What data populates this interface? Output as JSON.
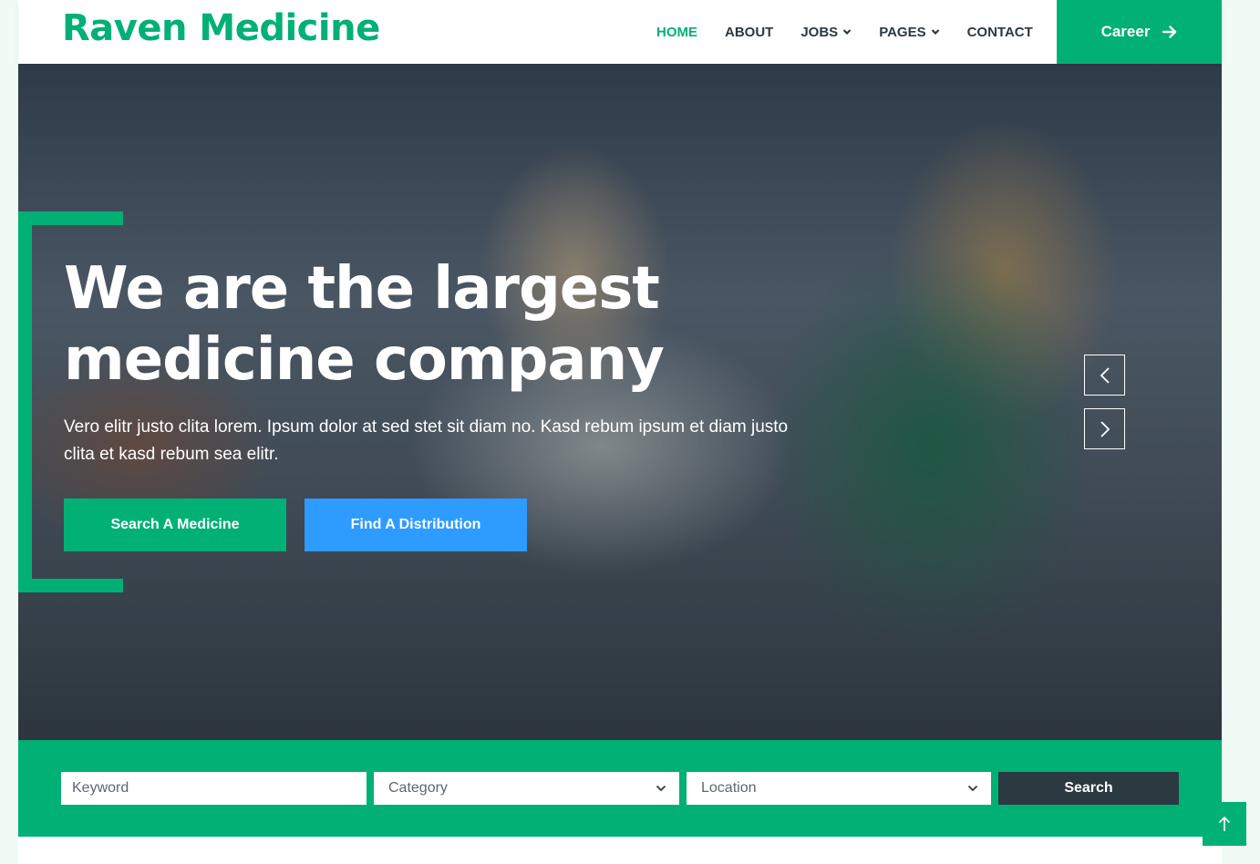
{
  "brand": {
    "name": "Raven Medicine"
  },
  "nav": {
    "items": [
      {
        "label": "HOME",
        "active": true,
        "dropdown": false
      },
      {
        "label": "ABOUT",
        "active": false,
        "dropdown": false
      },
      {
        "label": "JOBS",
        "active": false,
        "dropdown": true
      },
      {
        "label": "PAGES",
        "active": false,
        "dropdown": true
      },
      {
        "label": "CONTACT",
        "active": false,
        "dropdown": false
      }
    ],
    "career_label": "Career",
    "career_icon": "arrow-right-icon"
  },
  "hero": {
    "title_line1": "We are the largest",
    "title_line2": "medicine company",
    "description": "Vero elitr justo clita lorem. Ipsum dolor at sed stet sit diam no. Kasd rebum ipsum et diam justo clita et kasd rebum sea elitr.",
    "primary_button": "Search A Medicine",
    "secondary_button": "Find A Distribution",
    "prev_icon": "chevron-left-icon",
    "next_icon": "chevron-right-icon"
  },
  "search": {
    "keyword_placeholder": "Keyword",
    "category_value": "Category",
    "location_value": "Location",
    "button_label": "Search"
  },
  "back_to_top_icon": "arrow-up-icon",
  "colors": {
    "accent": "#00b074",
    "secondary": "#2e9cff",
    "dark": "#2b3940",
    "page_bg": "#f0fbf5"
  }
}
